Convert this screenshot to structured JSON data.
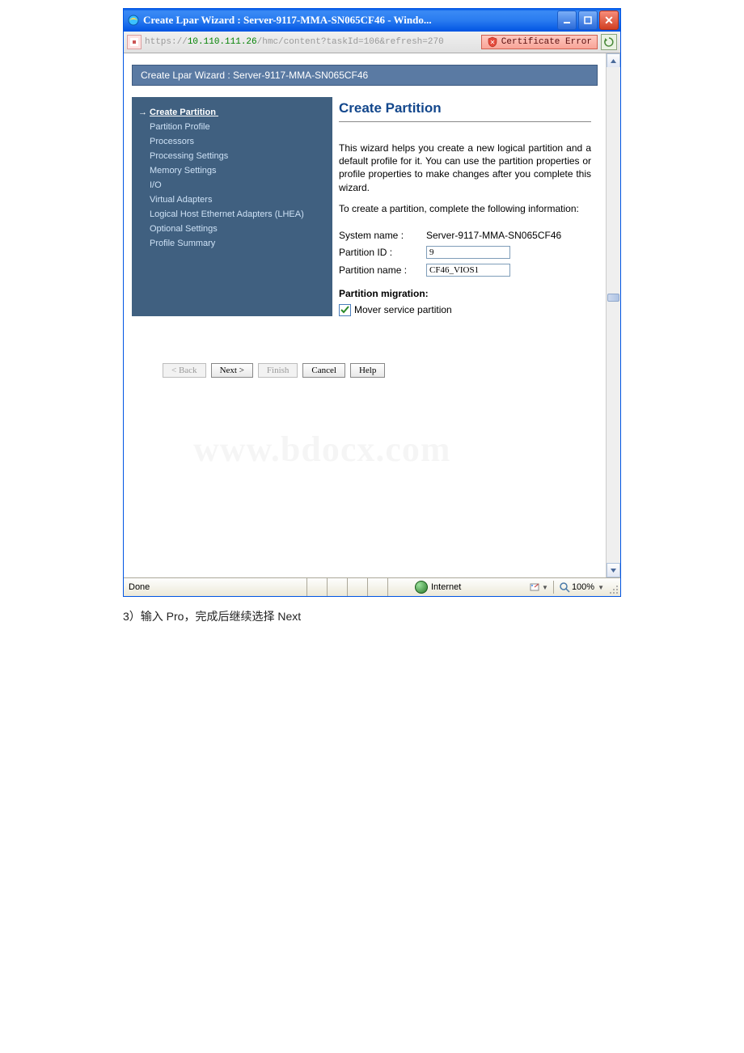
{
  "title": "Create Lpar Wizard : Server-9117-MMA-SN065CF46 - Windo...",
  "url_prefix": "https://",
  "url_ip": "10.110.111.26",
  "url_rest": "/hmc/content?taskId=106&refresh=270",
  "cert_error": "Certificate Error",
  "hmc_header": "Create Lpar Wizard : Server-9117-MMA-SN065CF46",
  "nav": {
    "s0": "Create Partition",
    "s1": "Partition Profile",
    "s2": "Processors",
    "s3": "Processing Settings",
    "s4": "Memory Settings",
    "s5": "I/O",
    "s6": "Virtual Adapters",
    "s7": "Logical Host Ethernet Adapters (LHEA)",
    "s8": "Optional Settings",
    "s9": "Profile Summary"
  },
  "main": {
    "heading": "Create Partition",
    "para1": "This wizard helps you create a new logical partition and a default profile for it. You can use the partition properties or profile properties to make changes after you complete this wizard.",
    "para2": "To create a partition, complete the following information:",
    "labels": {
      "sysname": "System name :",
      "pid": "Partition ID :",
      "pname": "Partition name :"
    },
    "sysname": "Server-9117-MMA-SN065CF46",
    "pid": "9",
    "pname": "CF46_VIOS1",
    "mig_hd": "Partition migration:",
    "mover": "Mover service partition"
  },
  "buttons": {
    "back": "< Back",
    "next": "Next >",
    "finish": "Finish",
    "cancel": "Cancel",
    "help": "Help"
  },
  "status": {
    "done": "Done",
    "zone": "Internet",
    "zoom": "100%"
  },
  "watermark": "www.bdocx.com",
  "caption": "3）输入 Pro，完成后继续选择 Next"
}
